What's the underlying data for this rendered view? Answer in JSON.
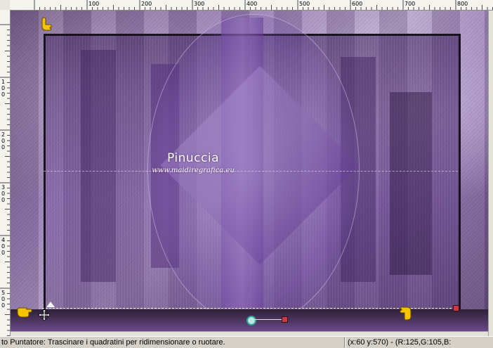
{
  "ruler": {
    "top_labels": [
      "100",
      "200",
      "300",
      "400",
      "500",
      "600",
      "700",
      "800"
    ],
    "left_labels": [
      "1 0 0",
      "2 0 0",
      "3 0 0",
      "4 0 0",
      "5 0 0"
    ]
  },
  "canvas": {
    "watermark_title": "Pinuccia",
    "watermark_url": "www.maidiregrafica.eu"
  },
  "icons": {
    "pointer_hand": "pointing-hand-icon",
    "move_cursor": "move-cursor-icon",
    "rotation_handle": "rotation-handle-icon"
  },
  "colors": {
    "accent_purple": "#8c72ad",
    "frame_border": "#1a1220",
    "handle_red": "#c73a4a",
    "rotation_teal": "#2aa398",
    "hand_yellow": "#f5c400"
  },
  "status": {
    "message": "to Puntatore: Trascinare i quadratini per ridimensionare o ruotare.",
    "coords": "(x:60 y:570) - (R:125,G:105,B:"
  }
}
